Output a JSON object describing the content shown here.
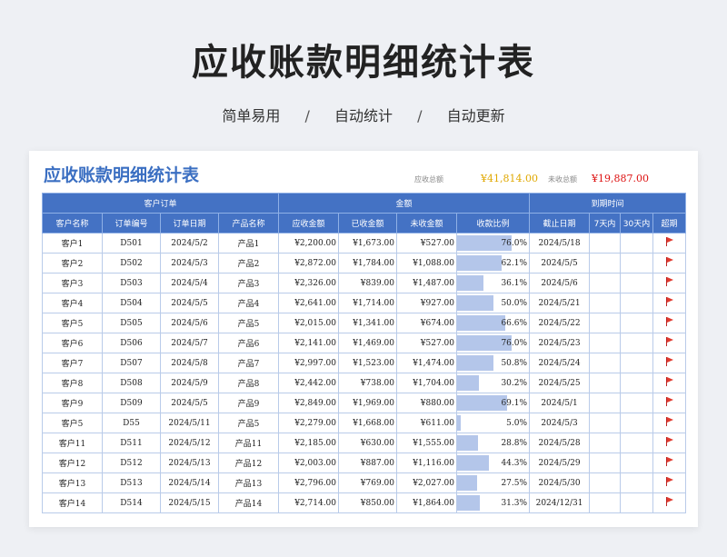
{
  "header": {
    "title": "应收账款明细统计表",
    "taglines": [
      "简单易用",
      "自动统计",
      "自动更新"
    ],
    "separator": "/"
  },
  "sheet": {
    "title": "应收账款明细统计表",
    "summary": {
      "receivable_label": "应收总额",
      "receivable_value": "¥41,814.00",
      "unreceived_label": "未收总额",
      "unreceived_value": "¥19,887.00"
    }
  },
  "table": {
    "groups": [
      "客户订单",
      "金额",
      "到期时间"
    ],
    "columns": [
      "客户名称",
      "订单编号",
      "订单日期",
      "产品名称",
      "应收金额",
      "已收金额",
      "未收金额",
      "收款比例",
      "截止日期",
      "7天内",
      "30天内",
      "超期"
    ],
    "rows": [
      {
        "customer": "客户1",
        "order": "D501",
        "date": "2024/5/2",
        "product": "产品1",
        "due": "¥2,200.00",
        "paid": "¥1,673.00",
        "unpaid": "¥527.00",
        "ratio_text": "76.0%",
        "ratio": 0.76,
        "deadline": "2024/5/18",
        "overdue": true
      },
      {
        "customer": "客户2",
        "order": "D502",
        "date": "2024/5/3",
        "product": "产品2",
        "due": "¥2,872.00",
        "paid": "¥1,784.00",
        "unpaid": "¥1,088.00",
        "ratio_text": "62.1%",
        "ratio": 0.621,
        "deadline": "2024/5/5",
        "overdue": true
      },
      {
        "customer": "客户3",
        "order": "D503",
        "date": "2024/5/4",
        "product": "产品3",
        "due": "¥2,326.00",
        "paid": "¥839.00",
        "unpaid": "¥1,487.00",
        "ratio_text": "36.1%",
        "ratio": 0.361,
        "deadline": "2024/5/6",
        "overdue": true
      },
      {
        "customer": "客户4",
        "order": "D504",
        "date": "2024/5/5",
        "product": "产品4",
        "due": "¥2,641.00",
        "paid": "¥1,714.00",
        "unpaid": "¥927.00",
        "ratio_text": "50.0%",
        "ratio": 0.5,
        "deadline": "2024/5/21",
        "overdue": true
      },
      {
        "customer": "客户5",
        "order": "D505",
        "date": "2024/5/6",
        "product": "产品5",
        "due": "¥2,015.00",
        "paid": "¥1,341.00",
        "unpaid": "¥674.00",
        "ratio_text": "66.6%",
        "ratio": 0.666,
        "deadline": "2024/5/22",
        "overdue": true
      },
      {
        "customer": "客户6",
        "order": "D506",
        "date": "2024/5/7",
        "product": "产品6",
        "due": "¥2,141.00",
        "paid": "¥1,469.00",
        "unpaid": "¥527.00",
        "ratio_text": "76.0%",
        "ratio": 0.76,
        "deadline": "2024/5/23",
        "overdue": true
      },
      {
        "customer": "客户7",
        "order": "D507",
        "date": "2024/5/8",
        "product": "产品7",
        "due": "¥2,997.00",
        "paid": "¥1,523.00",
        "unpaid": "¥1,474.00",
        "ratio_text": "50.8%",
        "ratio": 0.508,
        "deadline": "2024/5/24",
        "overdue": true
      },
      {
        "customer": "客户8",
        "order": "D508",
        "date": "2024/5/9",
        "product": "产品8",
        "due": "¥2,442.00",
        "paid": "¥738.00",
        "unpaid": "¥1,704.00",
        "ratio_text": "30.2%",
        "ratio": 0.302,
        "deadline": "2024/5/25",
        "overdue": true
      },
      {
        "customer": "客户9",
        "order": "D509",
        "date": "2024/5/5",
        "product": "产品9",
        "due": "¥2,849.00",
        "paid": "¥1,969.00",
        "unpaid": "¥880.00",
        "ratio_text": "69.1%",
        "ratio": 0.691,
        "deadline": "2024/5/1",
        "overdue": true
      },
      {
        "customer": "客户5",
        "order": "D55",
        "date": "2024/5/11",
        "product": "产品5",
        "due": "¥2,279.00",
        "paid": "¥1,668.00",
        "unpaid": "¥611.00",
        "ratio_text": "5.0%",
        "ratio": 0.05,
        "deadline": "2024/5/3",
        "overdue": true
      },
      {
        "customer": "客户11",
        "order": "D511",
        "date": "2024/5/12",
        "product": "产品11",
        "due": "¥2,185.00",
        "paid": "¥630.00",
        "unpaid": "¥1,555.00",
        "ratio_text": "28.8%",
        "ratio": 0.288,
        "deadline": "2024/5/28",
        "overdue": true
      },
      {
        "customer": "客户12",
        "order": "D512",
        "date": "2024/5/13",
        "product": "产品12",
        "due": "¥2,003.00",
        "paid": "¥887.00",
        "unpaid": "¥1,116.00",
        "ratio_text": "44.3%",
        "ratio": 0.443,
        "deadline": "2024/5/29",
        "overdue": true
      },
      {
        "customer": "客户13",
        "order": "D513",
        "date": "2024/5/14",
        "product": "产品13",
        "due": "¥2,796.00",
        "paid": "¥769.00",
        "unpaid": "¥2,027.00",
        "ratio_text": "27.5%",
        "ratio": 0.275,
        "deadline": "2024/5/30",
        "overdue": true
      },
      {
        "customer": "客户14",
        "order": "D514",
        "date": "2024/5/15",
        "product": "产品14",
        "due": "¥2,714.00",
        "paid": "¥850.00",
        "unpaid": "¥1,864.00",
        "ratio_text": "31.3%",
        "ratio": 0.313,
        "deadline": "2024/12/31",
        "overdue": true
      }
    ]
  },
  "colors": {
    "header_fill": "#4472c4",
    "ratio_bar": "#b4c6ea",
    "total_receivable": "#e0a800",
    "total_unreceived": "#dd1111",
    "overdue_flag": "#e03a2e"
  }
}
